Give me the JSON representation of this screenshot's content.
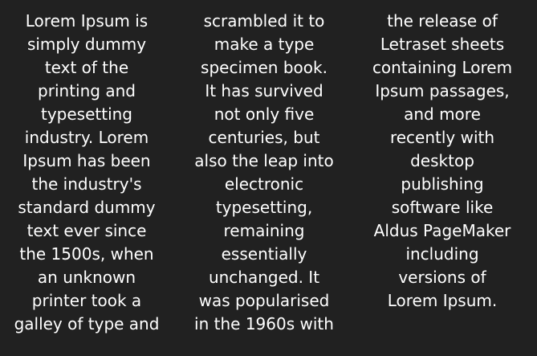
{
  "columns": [
    {
      "lines": [
        "Lorem Ipsum is",
        "simply dummy",
        "text of the",
        "printing and",
        "typesetting",
        "industry. Lorem",
        "Ipsum has been",
        "the industry's",
        "standard dummy",
        "text ever since",
        "the 1500s, when",
        "an unknown",
        "printer took a",
        "galley of type and"
      ]
    },
    {
      "lines": [
        "scrambled it to",
        "make a type",
        "specimen book.",
        "It has survived",
        "not only five",
        "centuries, but",
        "also the leap into",
        "electronic",
        "typesetting,",
        "remaining",
        "essentially",
        "unchanged. It",
        "was popularised",
        "in the 1960s with"
      ]
    },
    {
      "lines": [
        "the release of",
        "Letraset sheets",
        "containing Lorem",
        "Ipsum passages,",
        "and more",
        "recently with",
        "desktop",
        "publishing",
        "software like",
        "Aldus PageMaker",
        "including",
        "versions of",
        "Lorem Ipsum."
      ]
    }
  ]
}
